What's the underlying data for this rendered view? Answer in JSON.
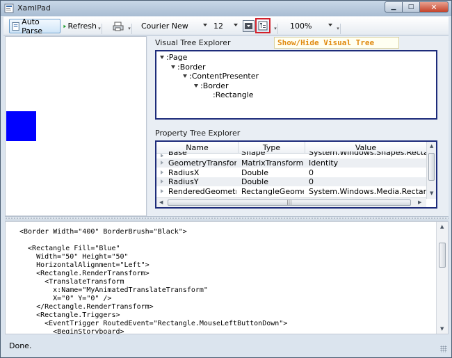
{
  "window": {
    "title": "XamlPad"
  },
  "toolbar": {
    "auto_parse_label": "Auto Parse",
    "refresh_label": "Refresh",
    "font_family": "Courier New",
    "font_size": "12",
    "zoom": "100%"
  },
  "tooltip": {
    "text": "Show/Hide Visual Tree"
  },
  "visual_tree": {
    "title": "Visual Tree Explorer",
    "nodes": [
      ":Page",
      ":Border",
      ":ContentPresenter",
      ":Border",
      ":Rectangle"
    ]
  },
  "property_tree": {
    "title": "Property Tree Explorer",
    "columns": [
      "Name",
      "Type",
      "Value"
    ],
    "rows": [
      {
        "name": "Base",
        "type": "Shape",
        "value": "System.Windows.Shapes.Rectangle"
      },
      {
        "name": "GeometryTransfor...",
        "type": "MatrixTransform",
        "value": "Identity"
      },
      {
        "name": "RadiusX",
        "type": "Double",
        "value": "0"
      },
      {
        "name": "RadiusY",
        "type": "Double",
        "value": "0"
      },
      {
        "name": "RenderedGeometry",
        "type": "RectangleGeometry",
        "value": "System.Windows.Media.RectangleGe"
      }
    ]
  },
  "code": {
    "lines": [
      "<Border Width=\"400\" BorderBrush=\"Black\">",
      "",
      "  <Rectangle Fill=\"Blue\"",
      "    Width=\"50\" Height=\"50\"",
      "    HorizontalAlignment=\"Left\">",
      "    <Rectangle.RenderTransform>",
      "      <TranslateTransform",
      "        x:Name=\"MyAnimatedTranslateTransform\"",
      "        X=\"0\" Y=\"0\" />",
      "    </Rectangle.RenderTransform>",
      "    <Rectangle.Triggers>",
      "      <EventTrigger RoutedEvent=\"Rectangle.MouseLeftButtonDown\">",
      "        <BeginStoryboard>"
    ]
  },
  "status": {
    "text": "Done."
  },
  "colors": {
    "preview_rect": "#0000ff",
    "tooltip_text": "#e08a10",
    "toggle_outline": "#d2202a"
  }
}
